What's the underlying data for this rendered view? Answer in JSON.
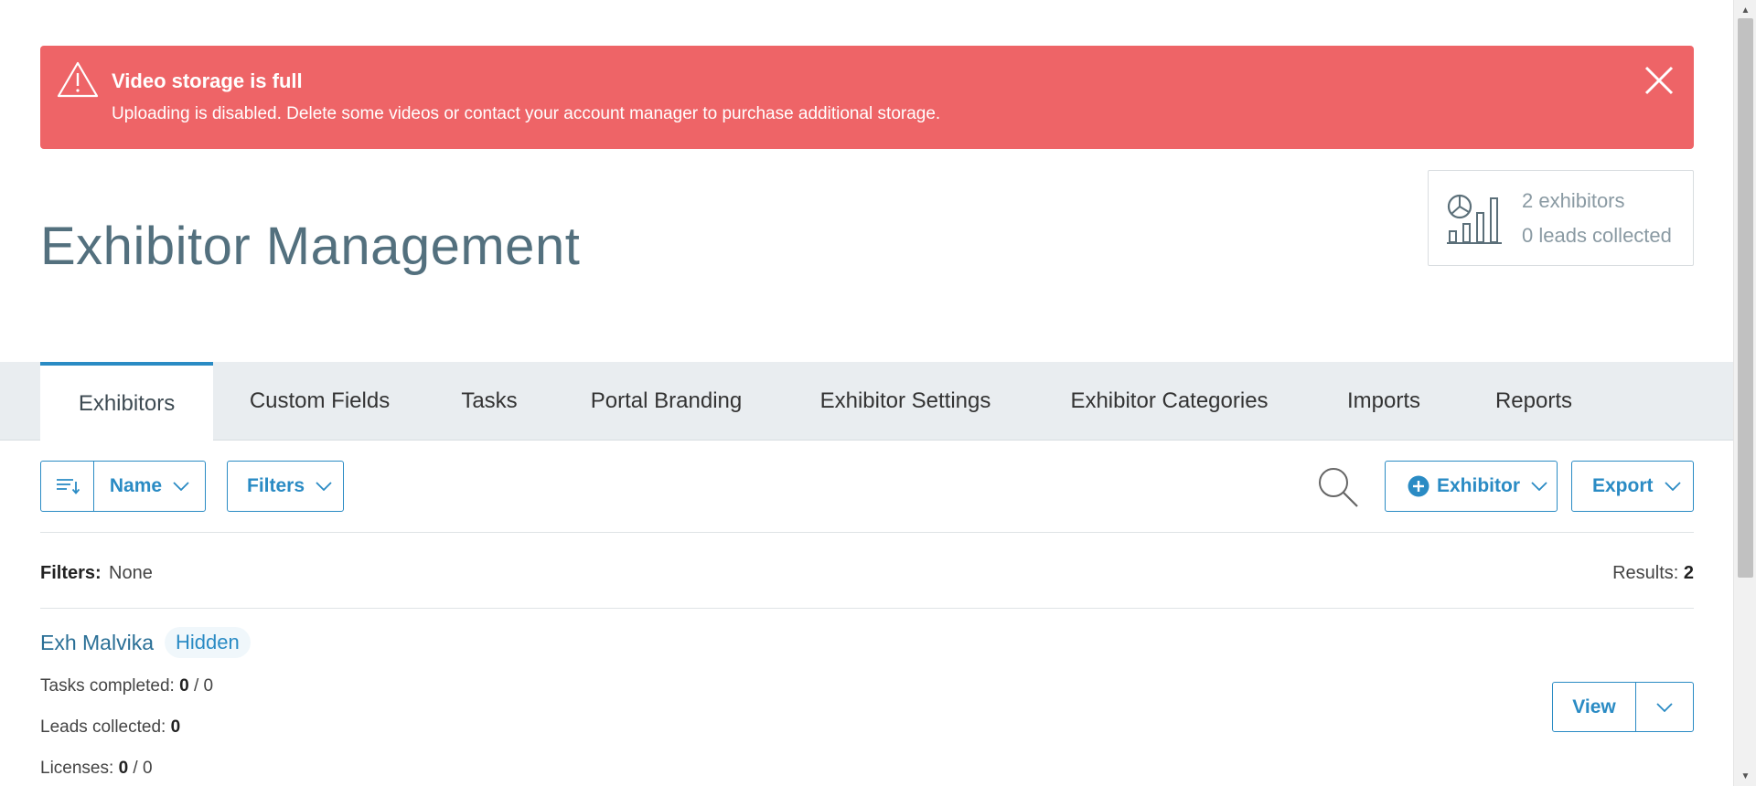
{
  "alert": {
    "title": "Video storage is full",
    "message": "Uploading is disabled. Delete some videos or contact your account manager to purchase additional storage.",
    "icon": "warning-triangle-icon",
    "close_icon": "close-icon",
    "background": "#ee6467"
  },
  "header": {
    "title": "Exhibitor Management"
  },
  "stats": {
    "icon": "chart-icon",
    "exhibitors": "2 exhibitors",
    "leads": "0 leads collected"
  },
  "tabs": [
    {
      "label": "Exhibitors",
      "active": true
    },
    {
      "label": "Custom Fields",
      "active": false
    },
    {
      "label": "Tasks",
      "active": false
    },
    {
      "label": "Portal Branding",
      "active": false
    },
    {
      "label": "Exhibitor Settings",
      "active": false
    },
    {
      "label": "Exhibitor Categories",
      "active": false
    },
    {
      "label": "Imports",
      "active": false
    },
    {
      "label": "Reports",
      "active": false
    }
  ],
  "toolbar": {
    "sort_label": "Name",
    "filters_label": "Filters",
    "add_label": "Exhibitor",
    "export_label": "Export"
  },
  "filters": {
    "label": "Filters:",
    "value": "None",
    "results_label": "Results:",
    "results_count": "2"
  },
  "exhibitors": [
    {
      "name": "Exh Malvika",
      "badge": "Hidden",
      "tasks_label": "Tasks completed:",
      "tasks_done": "0",
      "tasks_total": "/ 0",
      "leads_label": "Leads collected:",
      "leads_count": "0",
      "licenses_label": "Licenses:",
      "licenses_used": "0",
      "licenses_total": "/ 0",
      "view_label": "View"
    }
  ],
  "colors": {
    "accent": "#2a8bc4",
    "title": "#53707e",
    "tab_bar": "#e9edf0"
  }
}
